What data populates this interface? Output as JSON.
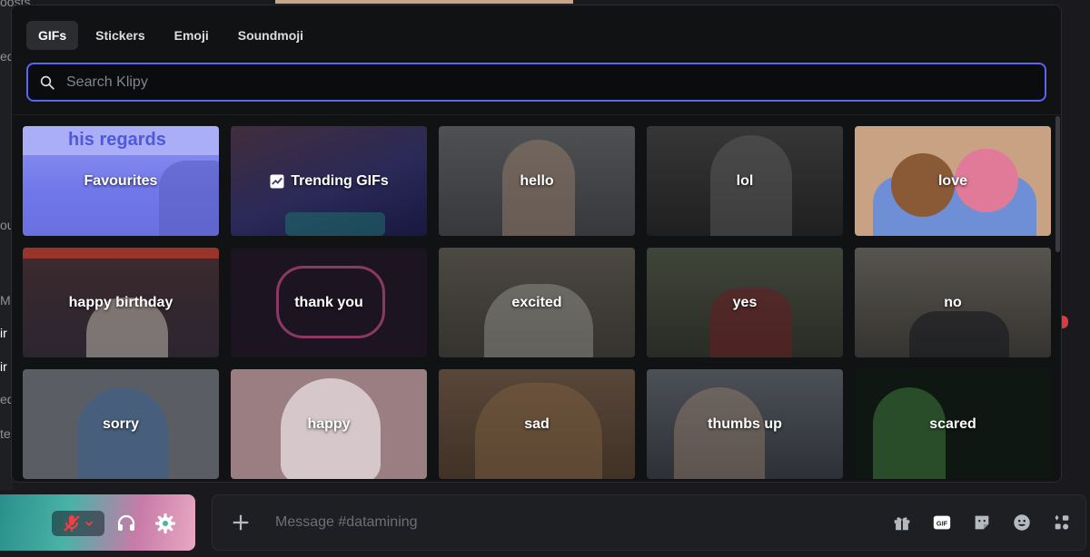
{
  "background": {
    "left_fragments": [
      "oosts",
      "ed",
      "ou",
      "Mi",
      "ir",
      "ir",
      "ed",
      "te"
    ]
  },
  "picker": {
    "tabs": [
      {
        "label": "GIFs",
        "active": true
      },
      {
        "label": "Stickers",
        "active": false
      },
      {
        "label": "Emoji",
        "active": false
      },
      {
        "label": "Soundmoji",
        "active": false
      }
    ],
    "search_placeholder": "Search Klipy",
    "tiles": [
      {
        "label": "Favourites",
        "color": "#6f76e6"
      },
      {
        "label": "Trending GIFs",
        "color": "#3b3a6b"
      },
      {
        "label": "hello",
        "color": "#5c5f64"
      },
      {
        "label": "lol",
        "color": "#3e3e3e"
      },
      {
        "label": "love",
        "color": "#b9876a"
      },
      {
        "label": "happy birthday",
        "color": "#3a2f3b"
      },
      {
        "label": "thank you",
        "color": "#2a1e2c"
      },
      {
        "label": "excited",
        "color": "#5a564f"
      },
      {
        "label": "yes",
        "color": "#48503f"
      },
      {
        "label": "no",
        "color": "#6a6660"
      },
      {
        "label": "sorry",
        "color": "#4b5056"
      },
      {
        "label": "happy",
        "color": "#8c7276"
      },
      {
        "label": "sad",
        "color": "#6e5a48"
      },
      {
        "label": "thumbs up",
        "color": "#5a6068"
      },
      {
        "label": "scared",
        "color": "#17211a"
      }
    ],
    "favourites_overlay_text": "his regards"
  },
  "composer": {
    "placeholder": "Message #datamining",
    "icons": [
      "gift-icon",
      "gif-icon",
      "sticker-icon",
      "emoji-icon",
      "apps-icon"
    ]
  },
  "user_panel": {
    "icons": [
      "mic-muted-icon",
      "chevron-down-icon",
      "headphones-icon",
      "gear-icon"
    ]
  }
}
